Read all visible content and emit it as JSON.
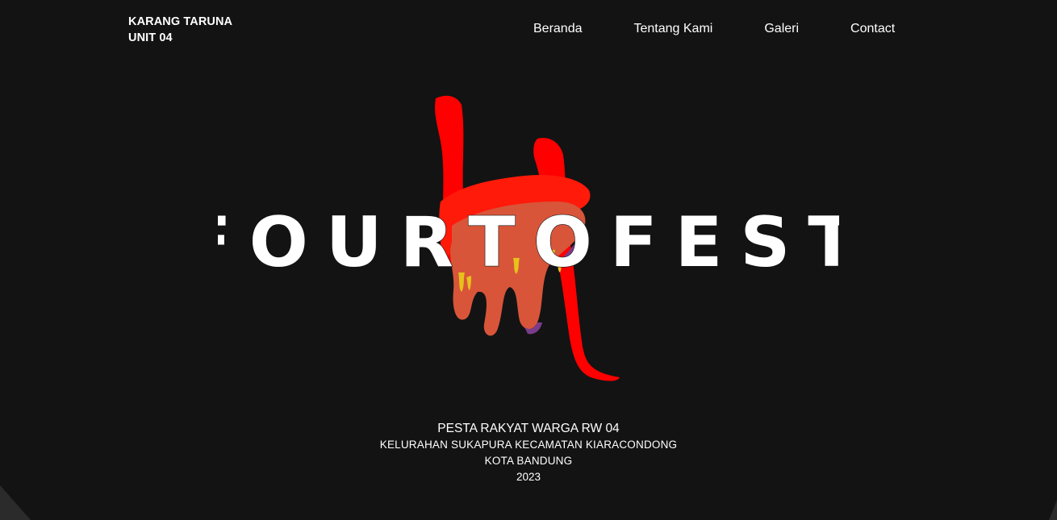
{
  "header": {
    "brand_line1": "KARANG TARUNA",
    "brand_line2": "UNIT 04"
  },
  "nav": {
    "items": [
      "Beranda",
      "Tentang Kami",
      "Galeri",
      "Contact"
    ]
  },
  "hero": {
    "logo_text": "FOURTOFEST",
    "logo_graphic": "red-paint-brushstroke-4",
    "colors": {
      "background": "#131313",
      "paint_red": "#ff0000",
      "paint_orange": "#d8553a",
      "drip_yellow": "#e6c21a",
      "drip_purple": "#7a3b8a",
      "text": "#ffffff"
    }
  },
  "event_info": {
    "line1": "PESTA RAKYAT WARGA RW 04",
    "line2": "KELURAHAN SUKAPURA KECAMATAN KIARACONDONG",
    "line3": "KOTA BANDUNG",
    "line4": "2023"
  }
}
